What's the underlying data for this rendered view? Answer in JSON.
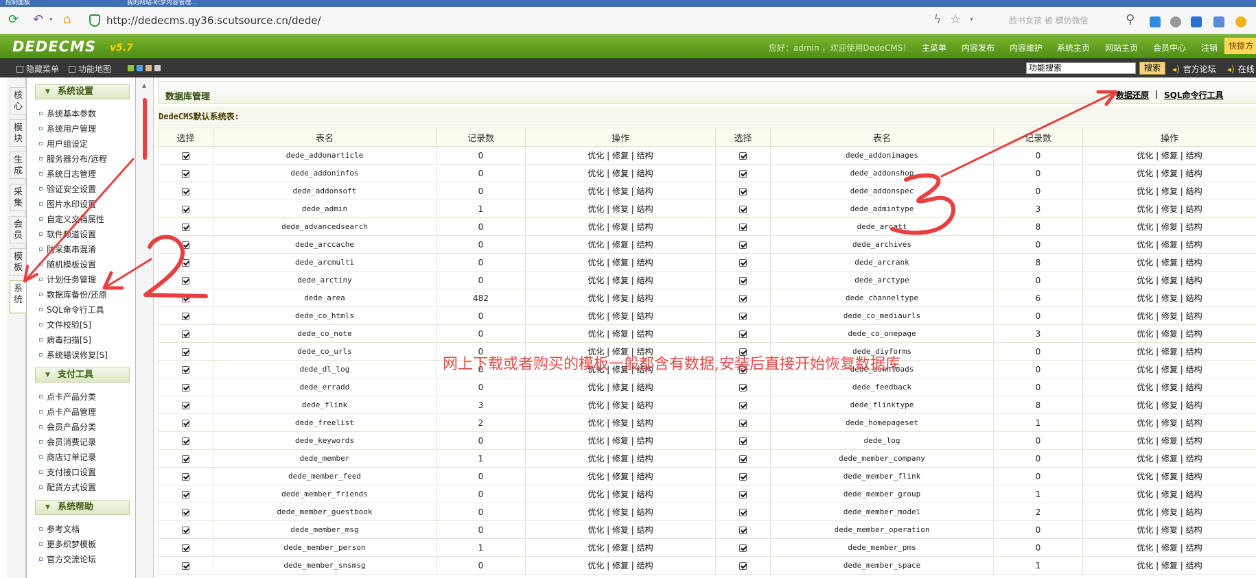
{
  "browser": {
    "tabs": [
      "控制面板",
      "我的网站-织梦内容管理..."
    ],
    "url": "http://dedecms.qy36.scutsource.cn/dede/",
    "search_placeholder": "脸书女孩 被 模仿微信"
  },
  "header": {
    "logo": "DEDECMS",
    "version": "v5.7",
    "welcome": "您好：admin ，欢迎使用DedeCMS！",
    "nav": [
      "主菜单",
      "内容发布",
      "内容维护",
      "系统主页",
      "网站主页",
      "会员中心",
      "注销",
      "快捷方"
    ]
  },
  "toolbar": {
    "hide_menu": "隐藏菜单",
    "func_map": "功能地图",
    "search_value": "功能搜索",
    "search_button": "搜索",
    "links": [
      "官方论坛",
      "在线"
    ]
  },
  "side_tabs": [
    "核心",
    "模块",
    "生成",
    "采集",
    "会员",
    "模板",
    "系统"
  ],
  "menu": {
    "sections": [
      {
        "title": "系统设置",
        "items": [
          "系统基本参数",
          "系统用户管理",
          "用户组设定",
          "服务器分布/远程",
          "系统日志管理",
          "验证安全设置",
          "图片水印设置",
          "自定义文档属性",
          "软件频道设置",
          "防采集串混淆",
          "随机模板设置",
          "计划任务管理",
          "数据库备份/还原",
          "SQL命令行工具",
          "文件校验[S]",
          "病毒扫描[S]",
          "系统错误修复[S]"
        ]
      },
      {
        "title": "支付工具",
        "items": [
          "点卡产品分类",
          "点卡产品管理",
          "会员产品分类",
          "会员消费记录",
          "商店订单记录",
          "支付接口设置",
          "配货方式设置"
        ]
      },
      {
        "title": "系统帮助",
        "items": [
          "参考文档",
          "更多织梦模板",
          "官方交流论坛"
        ]
      }
    ]
  },
  "main": {
    "title": "数据库管理",
    "link_restore": "数据还原",
    "link_sql": "SQL命令行工具",
    "link_sep": "|",
    "subtitle": "DedeCMS默认系统表:",
    "columns": [
      "选择",
      "表名",
      "记录数",
      "操作",
      "选择",
      "表名",
      "记录数",
      "操作"
    ],
    "op_text": "优化 | 修复 | 结构",
    "rows": [
      [
        "dede_addonarticle",
        "0",
        "dede_addonimages",
        "0"
      ],
      [
        "dede_addoninfos",
        "0",
        "dede_addonshop",
        "0"
      ],
      [
        "dede_addonsoft",
        "0",
        "dede_addonspec",
        "0"
      ],
      [
        "dede_admin",
        "1",
        "dede_admintype",
        "3"
      ],
      [
        "dede_advancedsearch",
        "0",
        "dede_arcatt",
        "8"
      ],
      [
        "dede_arccache",
        "0",
        "dede_archives",
        "0"
      ],
      [
        "dede_arcmulti",
        "0",
        "dede_arcrank",
        "8"
      ],
      [
        "dede_arctiny",
        "0",
        "dede_arctype",
        "0"
      ],
      [
        "dede_area",
        "482",
        "dede_channeltype",
        "6"
      ],
      [
        "dede_co_htmls",
        "0",
        "dede_co_mediaurls",
        "0"
      ],
      [
        "dede_co_note",
        "0",
        "dede_co_onepage",
        "3"
      ],
      [
        "dede_co_urls",
        "0",
        "dede_diyforms",
        "0"
      ],
      [
        "dede_dl_log",
        "0",
        "dede_downloads",
        "0"
      ],
      [
        "dede_erradd",
        "0",
        "dede_feedback",
        "0"
      ],
      [
        "dede_flink",
        "3",
        "dede_flinktype",
        "8"
      ],
      [
        "dede_freelist",
        "2",
        "dede_homepageset",
        "1"
      ],
      [
        "dede_keywords",
        "0",
        "dede_log",
        "0"
      ],
      [
        "dede_member",
        "1",
        "dede_member_company",
        "0"
      ],
      [
        "dede_member_feed",
        "0",
        "dede_member_flink",
        "0"
      ],
      [
        "dede_member_friends",
        "0",
        "dede_member_group",
        "1"
      ],
      [
        "dede_member_guestbook",
        "0",
        "dede_member_model",
        "2"
      ],
      [
        "dede_member_msg",
        "0",
        "dede_member_operation",
        "0"
      ],
      [
        "dede_member_person",
        "1",
        "dede_member_pms",
        "0"
      ],
      [
        "dede_member_snsmsg",
        "0",
        "dede_member_space",
        "1"
      ]
    ]
  },
  "annotation": {
    "text": "网上下载或者购买的模板一般都含有数据,安装后直接开始恢复数据库",
    "color": "#e84a4a",
    "numbers": [
      "2",
      "3"
    ]
  }
}
